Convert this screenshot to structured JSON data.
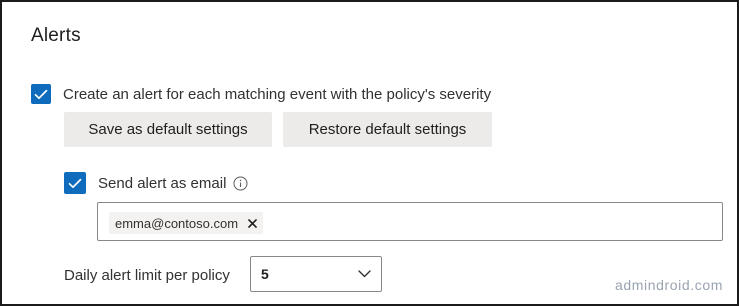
{
  "section": {
    "title": "Alerts"
  },
  "alert_option": {
    "checked": true,
    "label": "Create an alert for each matching event with the policy's severity"
  },
  "buttons": {
    "save_default": "Save as default settings",
    "restore_default": "Restore default settings"
  },
  "email_option": {
    "checked": true,
    "label": "Send alert as email",
    "icon": "info-icon"
  },
  "email_recipients": {
    "chips": [
      "emma@contoso.com"
    ],
    "remove_icon": "close-icon"
  },
  "daily_limit": {
    "label": "Daily alert limit per policy",
    "value": "5",
    "icon": "chevron-down-icon"
  },
  "watermark": {
    "text": "admindroid.com"
  },
  "colors": {
    "checkbox": "#0f6cbd",
    "button_bg": "#edebe9",
    "border": "#8a8886",
    "text": "#323130",
    "watermark": "#9aa4b1"
  }
}
